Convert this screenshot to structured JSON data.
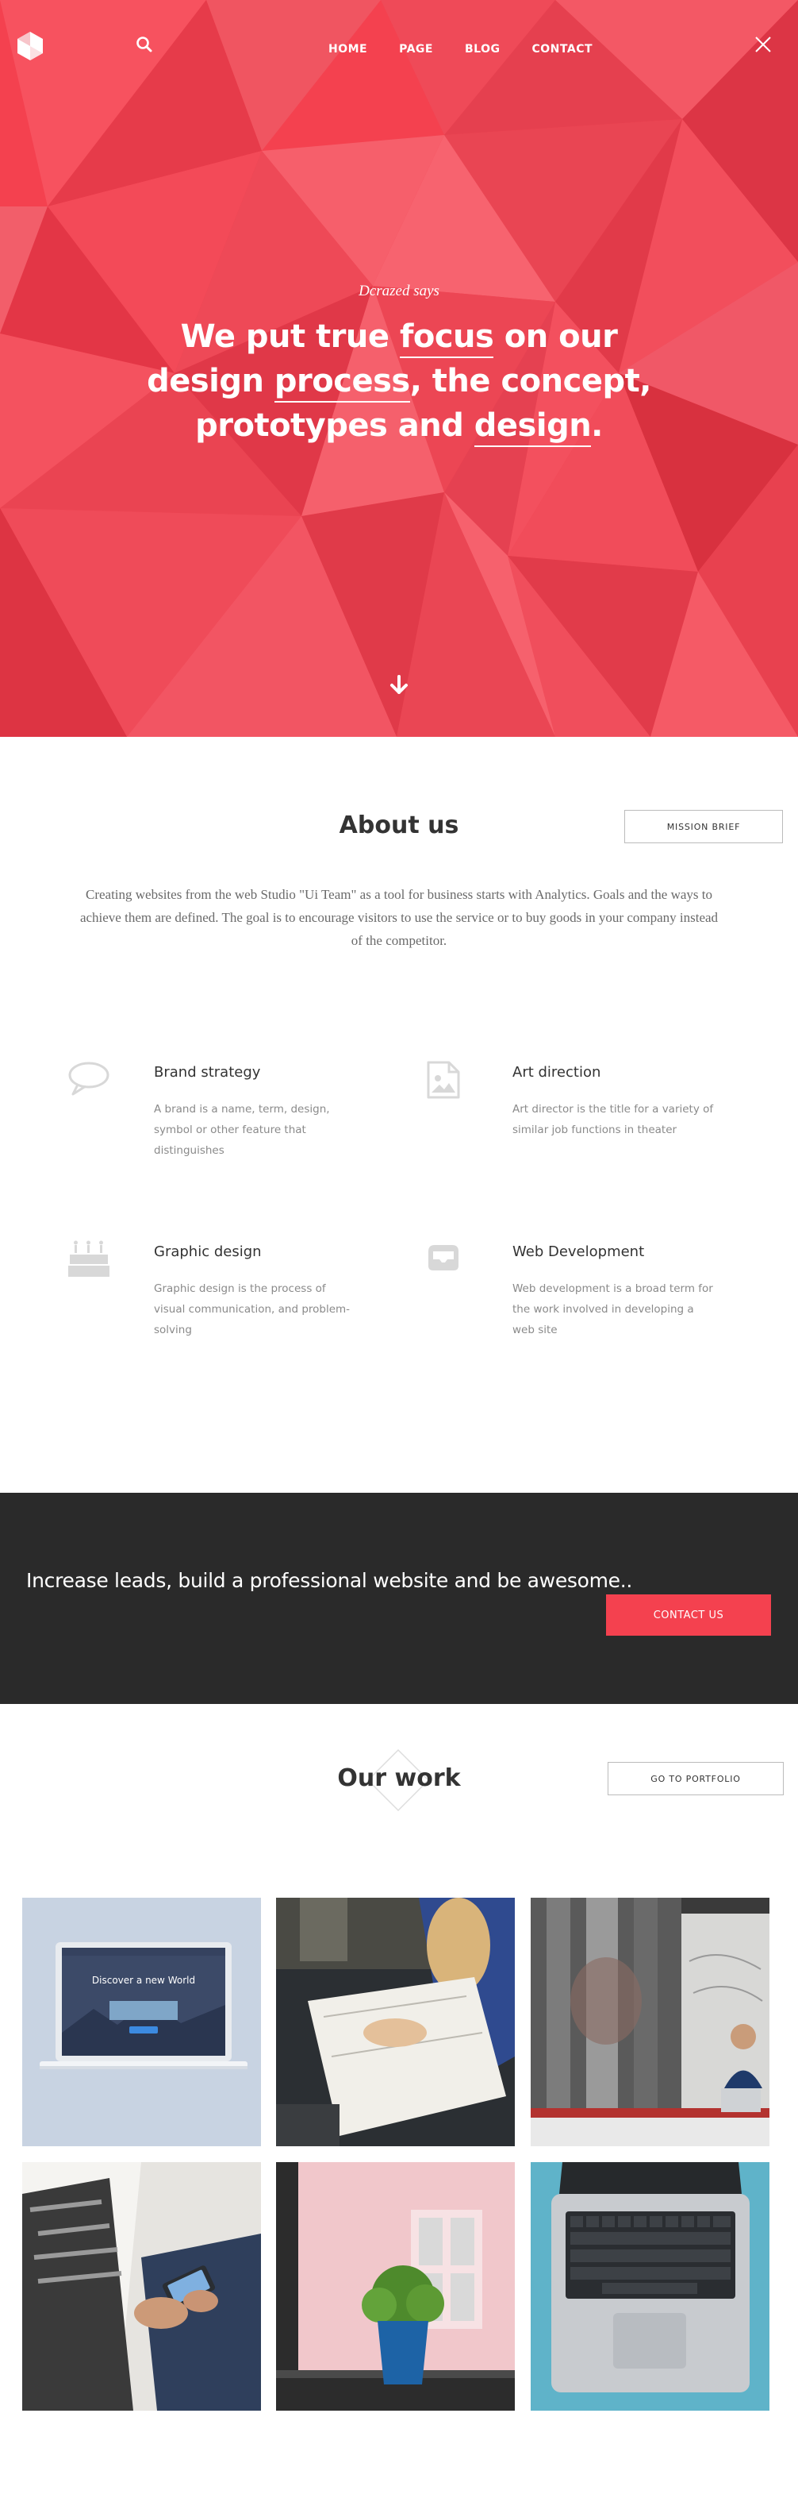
{
  "header": {
    "nav": [
      "HOME",
      "PAGE",
      "BLOG",
      "CONTACT"
    ]
  },
  "hero": {
    "says": "Dcrazed says",
    "headline": {
      "l1_a": "We put true ",
      "l1_u": "focus",
      "l1_b": " on our",
      "l2_a": "design ",
      "l2_u": "process",
      "l2_b": ", the concept,",
      "l3_a": "prototypes and ",
      "l3_u": "design",
      "l3_b": "."
    }
  },
  "about": {
    "title": "About us",
    "button": "MISSION BRIEF",
    "text": "Creating websites from the web Studio \"Ui Team\" as a tool for business starts with Analytics. Goals and the ways to achieve them are defined. The goal is to encourage visitors to use the service or to buy goods in your company instead of the competitor."
  },
  "services": [
    {
      "title": "Brand strategy",
      "text": "A brand is a name, term, design, symbol or other feature that distinguishes",
      "icon": "speech-bubble-icon"
    },
    {
      "title": "Art direction",
      "text": "Art director is the title for a variety of similar job functions in theater",
      "icon": "image-file-icon"
    },
    {
      "title": "Graphic design",
      "text": "Graphic design is the process of visual communication, and problem-solving",
      "icon": "birthday-cake-icon"
    },
    {
      "title": "Web Development",
      "text": "Web development is a broad term for the work involved in developing a web site",
      "icon": "inbox-tray-icon"
    }
  ],
  "cta": {
    "text": "Increase leads, build a professional website and be awesome..",
    "button": "CONTACT US"
  },
  "work": {
    "title": "Our work",
    "button": "GO TO PORTFOLIO",
    "mockup_title": "Discover a new World"
  },
  "colors": {
    "accent": "#f4414f",
    "dark": "#2a2a2a"
  }
}
